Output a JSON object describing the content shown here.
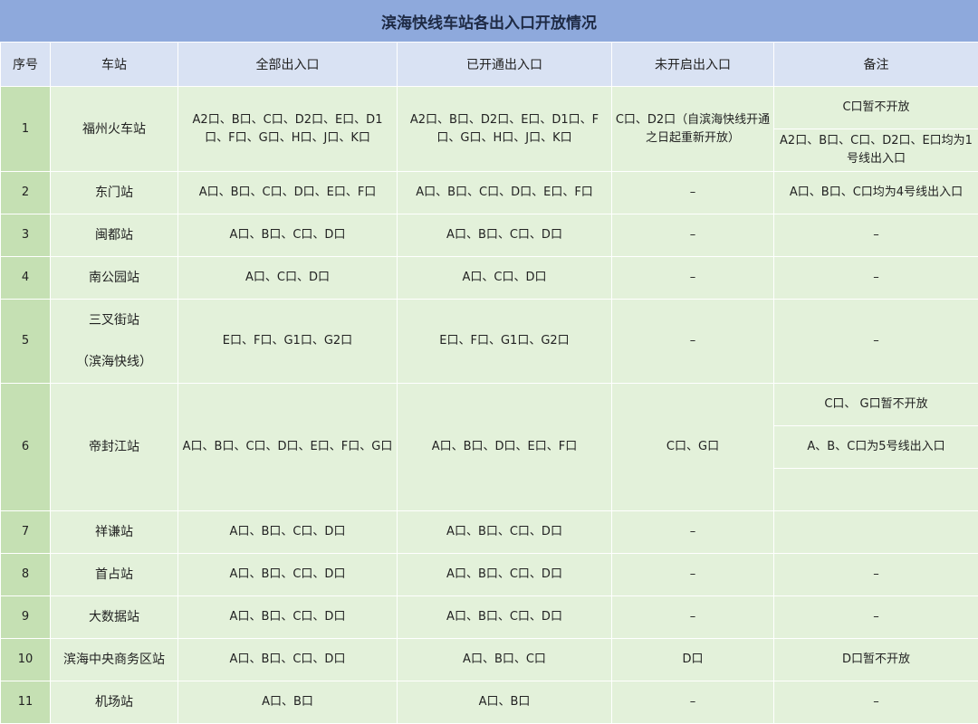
{
  "title": "滨海快线车站各出入口开放情况",
  "headers": [
    "序号",
    "车站",
    "全部出入口",
    "已开通出入口",
    "未开启出入口",
    "备注"
  ],
  "rows": [
    {
      "seq": "1",
      "station": "福州火车站",
      "all": "A2口、B口、C口、D2口、E口、D1口、F口、G口、H口、J口、K口",
      "open": "A2口、B口、D2口、E口、D1口、F口、G口、H口、J口、K口",
      "closed": "C口、D2口（自滨海快线开通之日起重新开放）",
      "notes": [
        "C口暂不开放",
        "A2口、B口、C口、D2口、E口均为1号线出入口"
      ]
    },
    {
      "seq": "2",
      "station": "东门站",
      "all": "A口、B口、C口、D口、E口、F口",
      "open": "A口、B口、C口、D口、E口、F口",
      "closed": "–",
      "notes": [
        "A口、B口、C口均为4号线出入口"
      ]
    },
    {
      "seq": "3",
      "station": "闽都站",
      "all": "A口、B口、C口、D口",
      "open": "A口、B口、C口、D口",
      "closed": "–",
      "notes": [
        "–"
      ]
    },
    {
      "seq": "4",
      "station": "南公园站",
      "all": "A口、C口、D口",
      "open": "A口、C口、D口",
      "closed": "–",
      "notes": [
        "–"
      ]
    },
    {
      "seq": "5",
      "station": "三叉街站",
      "station_sub": "（滨海快线）",
      "all": "E口、F口、G1口、G2口",
      "open": "E口、F口、G1口、G2口",
      "closed": "–",
      "notes": [
        "–"
      ]
    },
    {
      "seq": "6",
      "station": "帝封江站",
      "all": "A口、B口、C口、D口、E口、F口、G口",
      "open": "A口、B口、D口、E口、F口",
      "closed": "C口、G口",
      "notes": [
        "C口、 G口暂不开放",
        "A、B、C口为5号线出入口",
        ""
      ]
    },
    {
      "seq": "7",
      "station": "祥谦站",
      "all": "A口、B口、C口、D口",
      "open": "A口、B口、C口、D口",
      "closed": "–",
      "notes": [
        ""
      ]
    },
    {
      "seq": "8",
      "station": "首占站",
      "all": "A口、B口、C口、D口",
      "open": "A口、B口、C口、D口",
      "closed": "–",
      "notes": [
        "–"
      ]
    },
    {
      "seq": "9",
      "station": "大数据站",
      "all": "A口、B口、C口、D口",
      "open": "A口、B口、C口、D口",
      "closed": "–",
      "notes": [
        "–"
      ]
    },
    {
      "seq": "10",
      "station": "滨海中央商务区站",
      "all": "A口、B口、C口、D口",
      "open": "A口、B口、C口",
      "closed": "D口",
      "notes": [
        "D口暂不开放"
      ]
    },
    {
      "seq": "11",
      "station": "机场站",
      "all": "A口、B口",
      "open": "A口、B口",
      "closed": "–",
      "notes": [
        "–"
      ]
    }
  ]
}
